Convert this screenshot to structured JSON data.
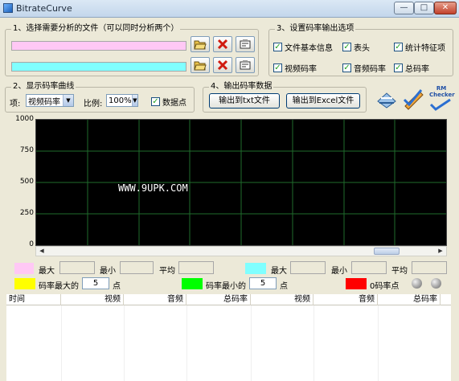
{
  "window": {
    "title": "BitrateCurve",
    "btn_min": "—",
    "btn_max": "□",
    "btn_close": "✕"
  },
  "group_files": {
    "legend": "1、选择需要分析的文件（可以同时分析两个）",
    "file1_value": "",
    "file2_value": "",
    "file1_color": "#ffc8f5",
    "file2_color": "#80ffff"
  },
  "group_output_opts": {
    "legend": "3、设置码率输出选项",
    "options": [
      "文件基本信息",
      "表头",
      "统计特征项",
      "视频码率",
      "音频码率",
      "总码率"
    ]
  },
  "group_curve": {
    "legend": "2、显示码率曲线",
    "item_label": "项:",
    "item_value": "视频码率",
    "scale_label": "比例:",
    "scale_value": "100%",
    "points_label": "数据点"
  },
  "group_export": {
    "legend": "4、输出码率数据",
    "txt_button": "输出到txt文件",
    "excel_button": "输出到Excel文件"
  },
  "tools": {
    "rm_label": "RM\nChecker"
  },
  "chart_data": {
    "type": "line",
    "series": [],
    "ylim": [
      0,
      1000
    ],
    "y_ticks": [
      "1000",
      "750",
      "500",
      "250",
      "0"
    ],
    "grid": true,
    "watermark": "WWW.9UPK.COM"
  },
  "stats": {
    "max_label": "最大",
    "min_label": "最小",
    "avg_label": "平均",
    "color1": "#ffc8f5",
    "color2": "#80ffff"
  },
  "markers": {
    "max_label": "码率最大的",
    "max_value": "5",
    "min_label": "码率最小的",
    "min_value": "5",
    "zero_label": "0码率点",
    "unit": "点",
    "max_color": "#ffff00",
    "min_color": "#00ff00",
    "zero_color": "#ff0000"
  },
  "table": {
    "columns": [
      "时间",
      "视频",
      "音频",
      "总码率",
      "视频",
      "音频",
      "总码率"
    ]
  }
}
